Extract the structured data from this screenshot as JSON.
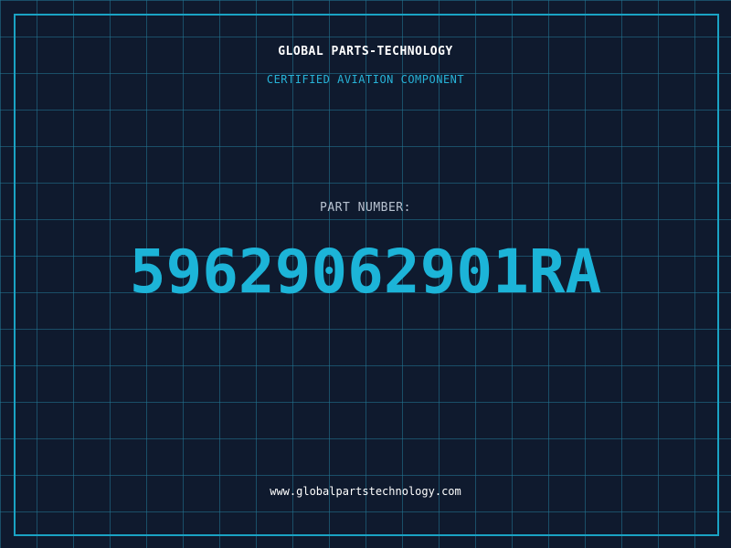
{
  "header": {
    "company": "GLOBAL PARTS-TECHNOLOGY",
    "certification": "CERTIFIED AVIATION COMPONENT"
  },
  "part": {
    "label": "PART NUMBER:",
    "number": "59629062901RA"
  },
  "footer": {
    "url": "www.globalpartstechnology.com"
  },
  "colors": {
    "background": "#0f1a2e",
    "grid": "#22789b",
    "accent": "#1cb4d8",
    "text": "#ffffff"
  }
}
